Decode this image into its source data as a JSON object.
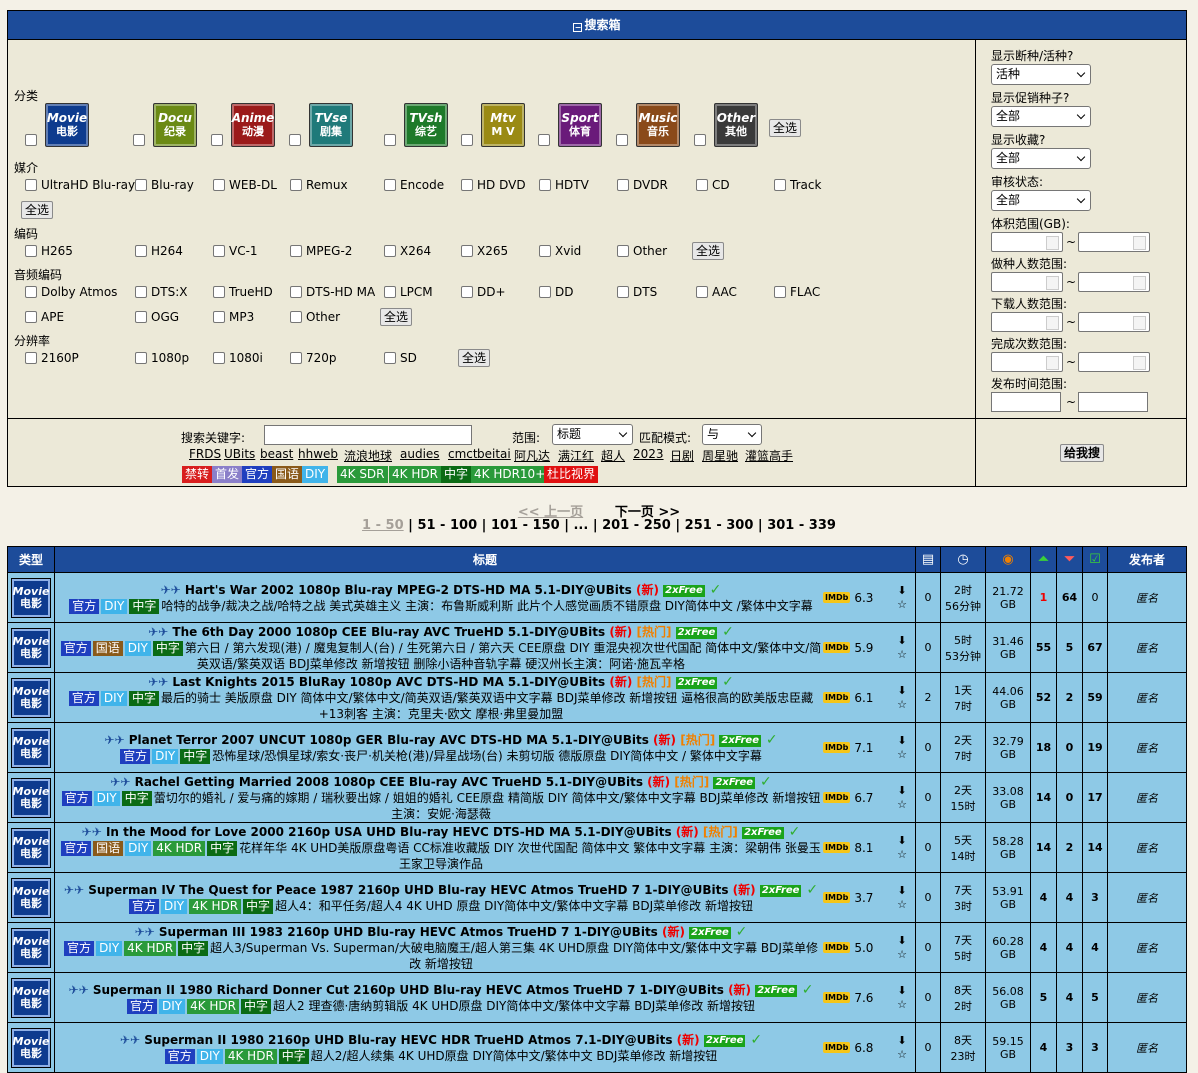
{
  "search_box": {
    "title": "搜索箱",
    "labels": {
      "category": "分类",
      "medium": "媒介",
      "codec": "编码",
      "audio": "音频编码",
      "resolution": "分辨率"
    },
    "categories": [
      {
        "en": "Movie",
        "zh": "电影",
        "color": "#0e3b8e"
      },
      {
        "en": "Docu",
        "zh": "纪录",
        "color": "#6b8a14"
      },
      {
        "en": "Anime",
        "zh": "动漫",
        "color": "#9b1a1a"
      },
      {
        "en": "TVse",
        "zh": "剧集",
        "color": "#1f7a7a"
      },
      {
        "en": "TVsh",
        "zh": "综艺",
        "color": "#1e7a2a"
      },
      {
        "en": "Mtv",
        "zh": "M V",
        "color": "#9a8a14"
      },
      {
        "en": "Sport",
        "zh": "体育",
        "color": "#6a1a7a"
      },
      {
        "en": "Music",
        "zh": "音乐",
        "color": "#8a4a1a"
      },
      {
        "en": "Other",
        "zh": "其他",
        "color": "#3a3a3a"
      }
    ],
    "select_all": "全选",
    "medium_opts": [
      "UltraHD Blu-ray",
      "Blu-ray",
      "WEB-DL",
      "Remux",
      "Encode",
      "HD DVD",
      "HDTV",
      "DVDR",
      "CD",
      "Track"
    ],
    "codec_opts": [
      "H265",
      "H264",
      "VC-1",
      "MPEG-2",
      "X264",
      "X265",
      "Xvid",
      "Other"
    ],
    "audio_opts_1": [
      "Dolby Atmos",
      "DTS:X",
      "TrueHD",
      "DTS-HD MA",
      "LPCM",
      "DD+",
      "DD",
      "DTS",
      "AAC",
      "FLAC"
    ],
    "audio_opts_2": [
      "APE",
      "OGG",
      "MP3",
      "Other"
    ],
    "res_opts": [
      "2160P",
      "1080p",
      "1080i",
      "720p",
      "SD"
    ],
    "right": {
      "show_dead": "显示断种/活种?",
      "show_dead_val": "活种",
      "show_promo": "显示促销种子?",
      "show_promo_val": "全部",
      "show_fav": "显示收藏?",
      "show_fav_val": "全部",
      "audit": "审核状态:",
      "audit_val": "全部",
      "size_range": "体积范围(GB):",
      "seeders_range": "做种人数范围:",
      "leechers_range": "下载人数范围:",
      "completed_range": "完成次数范围:",
      "time_range": "发布时间范围:",
      "tilde": "~"
    },
    "keyword_label": "搜索关键字:",
    "scope_label": "范围:",
    "scope_val": "标题",
    "match_label": "匹配模式:",
    "match_val": "与",
    "submit": "给我搜",
    "quick_links": [
      "FRDS",
      "UBits",
      "beast",
      "hhweb",
      "流浪地球",
      "audies",
      "cmct",
      "beitai",
      "阿凡达",
      "满江红",
      "超人",
      "2023",
      "日剧",
      "周星驰",
      "灌篮高手"
    ],
    "tags": [
      {
        "t": "禁转",
        "c": "#d81e1e"
      },
      {
        "t": "首发",
        "c": "#8a7fc9"
      },
      {
        "t": "官方",
        "c": "#1f3fbf"
      },
      {
        "t": "国语",
        "c": "#8a5a1a"
      },
      {
        "t": "DIY",
        "c": "#40b4ea"
      },
      {
        "t": "4K SDR",
        "c": "#2a9a3a"
      },
      {
        "t": "4K HDR",
        "c": "#2a9a3a"
      },
      {
        "t": "中字",
        "c": "#0b6b14"
      },
      {
        "t": "4K HDR10+",
        "c": "#2a9a3a"
      },
      {
        "t": "杜比视界",
        "c": "#e01010"
      }
    ]
  },
  "pager": {
    "prev": "<< 上一页",
    "next": "下一页 >>",
    "pages": [
      "1 - 50",
      "51 - 100",
      "101 - 150",
      "...",
      "201 - 250",
      "251 - 300",
      "301 - 339"
    ],
    "sep": "|"
  },
  "table": {
    "headers": {
      "type": "类型",
      "title": "标题",
      "poster": "发布者"
    },
    "rows": [
      {
        "title": "Hart's War 2002 1080p Blu-ray MPEG-2 DTS-HD MA 5.1-DIY@UBits",
        "hot": false,
        "badges": [
          "官方",
          "DIY",
          "中字"
        ],
        "sub": "哈特的战争/裁决之战/哈特之战 美式英雄主义 主演：布鲁斯威利斯 此片个人感觉画质不错原盘 DIY简体中文 /繁体中文字幕",
        "rating": "6.3",
        "comments": "0",
        "time": [
          "2时",
          "56分钟"
        ],
        "size": [
          "21.72",
          "GB"
        ],
        "seeders": "1",
        "leechers": "64",
        "done": "0",
        "poster": "匿名",
        "seed_red": true
      },
      {
        "title": "The 6th Day 2000 1080p CEE Blu-ray AVC TrueHD 5.1-DIY@UBits",
        "hot": true,
        "badges": [
          "官方",
          "国语",
          "DIY",
          "中字"
        ],
        "sub": "第六日 / 第六发现(港) / 魔鬼复制人(台) / 生死第六日 / 第六天 CEE原盘 DIY 重混央视次世代国配 简体中文/繁体中文/简英双语/繁英双语 BDJ菜单修改 新增按钮 删除小语种音轨字幕 硬汉州长主演：阿诺·施瓦辛格",
        "rating": "5.9",
        "comments": "0",
        "time": [
          "5时",
          "53分钟"
        ],
        "size": [
          "31.46",
          "GB"
        ],
        "seeders": "55",
        "leechers": "5",
        "done": "67",
        "poster": "匿名",
        "seed_red": false
      },
      {
        "title": "Last Knights 2015 BluRay 1080p AVC DTS-HD MA 5.1-DIY@UBits",
        "hot": true,
        "badges": [
          "官方",
          "DIY",
          "中字"
        ],
        "sub": "最后的骑士 美版原盘 DIY 简体中文/繁体中文/简英双语/繁英双语中文字幕 BDJ菜单修改 新增按钮 逼格很高的欧美版忠臣藏+13刺客 主演：克里夫·欧文 摩根·弗里曼加盟",
        "rating": "6.1",
        "comments": "2",
        "time": [
          "1天",
          "7时"
        ],
        "size": [
          "44.06",
          "GB"
        ],
        "seeders": "52",
        "leechers": "2",
        "done": "59",
        "poster": "匿名",
        "seed_red": false
      },
      {
        "title": "Planet Terror 2007 UNCUT 1080p GER Blu-ray AVC DTS-HD MA 5.1-DIY@UBits",
        "hot": true,
        "badges": [
          "官方",
          "DIY",
          "中字"
        ],
        "sub": "恐怖星球/恐惧星球/索女·丧尸·机关枪(港)/异星战场(台) 未剪切版 德版原盘 DIY简体中文 / 繁体中文字幕",
        "rating": "7.1",
        "comments": "0",
        "time": [
          "2天",
          "7时"
        ],
        "size": [
          "32.79",
          "GB"
        ],
        "seeders": "18",
        "leechers": "0",
        "done": "19",
        "poster": "匿名",
        "seed_red": false
      },
      {
        "title": "Rachel Getting Married 2008 1080p CEE Blu-ray AVC TrueHD 5.1-DIY@UBits",
        "hot": true,
        "badges": [
          "官方",
          "DIY",
          "中字"
        ],
        "sub": "蕾切尔的婚礼 / 爱与痛的嫁期 / 瑞秋要出嫁 / 姐姐的婚礼 CEE原盘 精简版 DIY 简体中文/繁体中文字幕 BDJ菜单修改 新增按钮 主演：安妮·海瑟薇",
        "rating": "6.7",
        "comments": "0",
        "time": [
          "2天",
          "15时"
        ],
        "size": [
          "33.08",
          "GB"
        ],
        "seeders": "14",
        "leechers": "0",
        "done": "17",
        "poster": "匿名",
        "seed_red": false
      },
      {
        "title": "In the Mood for Love 2000 2160p USA UHD Blu-ray HEVC DTS-HD MA 5.1-DIY@UBits",
        "hot": true,
        "badges": [
          "官方",
          "国语",
          "DIY",
          "4K HDR",
          "中字"
        ],
        "sub": "花样年华 4K UHD美版原盘粤语 CC标准收藏版 DIY 次世代国配 简体中文 繁体中文字幕 主演：梁朝伟 张曼玉 王家卫导演作品",
        "rating": "8.1",
        "comments": "0",
        "time": [
          "5天",
          "14时"
        ],
        "size": [
          "58.28",
          "GB"
        ],
        "seeders": "14",
        "leechers": "2",
        "done": "14",
        "poster": "匿名",
        "seed_red": false
      },
      {
        "title": "Superman IV The Quest for Peace 1987 2160p UHD Blu-ray HEVC Atmos TrueHD 7 1-DIY@UBits",
        "hot": false,
        "badges": [
          "官方",
          "DIY",
          "4K HDR",
          "中字"
        ],
        "sub": "超人4：和平任务/超人4 4K UHD 原盘 DIY简体中文/繁体中文字幕 BDJ菜单修改 新增按钮",
        "rating": "3.7",
        "comments": "0",
        "time": [
          "7天",
          "3时"
        ],
        "size": [
          "53.91",
          "GB"
        ],
        "seeders": "4",
        "leechers": "4",
        "done": "3",
        "poster": "匿名",
        "seed_red": false
      },
      {
        "title": "Superman III 1983 2160p UHD Blu-ray HEVC Atmos TrueHD 7 1-DIY@UBits",
        "hot": false,
        "badges": [
          "官方",
          "DIY",
          "4K HDR",
          "中字"
        ],
        "sub": "超人3/Superman Vs. Superman/大破电脑魔王/超人第三集 4K UHD原盘 DIY简体中文/繁体中文字幕 BDJ菜单修改 新增按钮",
        "rating": "5.0",
        "comments": "0",
        "time": [
          "7天",
          "5时"
        ],
        "size": [
          "60.28",
          "GB"
        ],
        "seeders": "4",
        "leechers": "4",
        "done": "4",
        "poster": "匿名",
        "seed_red": false
      },
      {
        "title": "Superman II 1980 Richard Donner Cut 2160p UHD Blu-ray HEVC Atmos TrueHD 7 1-DIY@UBits",
        "hot": false,
        "badges": [
          "官方",
          "DIY",
          "4K HDR",
          "中字"
        ],
        "sub": "超人2 理查德·唐纳剪辑版 4K UHD原盘 DIY简体中文/繁体中文字幕 BDJ菜单修改 新增按钮",
        "rating": "7.6",
        "comments": "0",
        "time": [
          "8天",
          "2时"
        ],
        "size": [
          "56.08",
          "GB"
        ],
        "seeders": "5",
        "leechers": "4",
        "done": "5",
        "poster": "匿名",
        "seed_red": false
      },
      {
        "title": "Superman II 1980 2160p UHD Blu-ray HEVC HDR TrueHD Atmos 7.1-DIY@UBits",
        "hot": false,
        "badges": [
          "官方",
          "DIY",
          "4K HDR",
          "中字"
        ],
        "sub": "超人2/超人续集 4K UHD原盘 DIY简体中文/繁体中文 BDJ菜单修改 新增按钮",
        "rating": "6.8",
        "comments": "0",
        "time": [
          "8天",
          "23时"
        ],
        "size": [
          "59.15",
          "GB"
        ],
        "seeders": "4",
        "leechers": "3",
        "done": "3",
        "poster": "匿名",
        "seed_red": false
      }
    ],
    "new_label": "(新)",
    "hot_label": "[热门]",
    "free_label": "2xFree"
  },
  "colors": {
    "header_blue": "#1d4c9a",
    "row_blue": "#8ec9e6"
  }
}
